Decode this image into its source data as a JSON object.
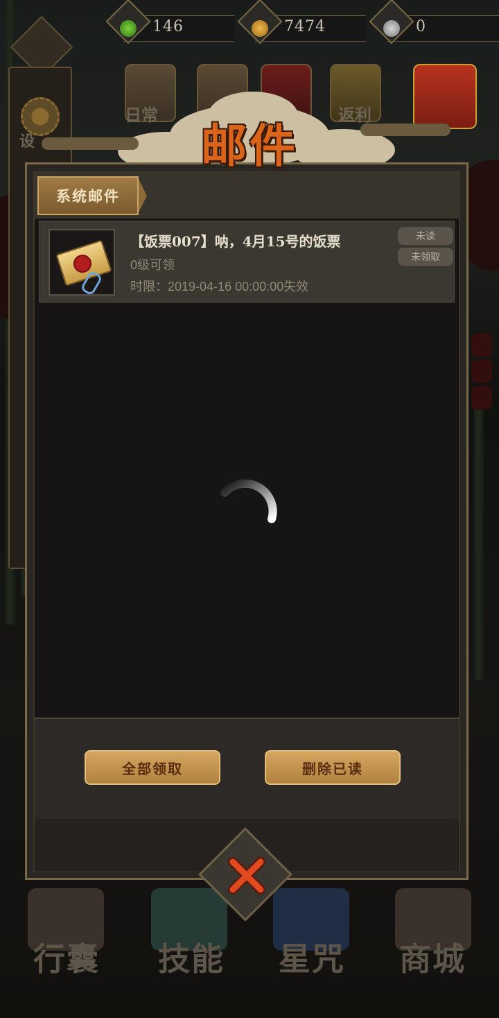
{
  "currency": {
    "jade": "146",
    "coin": "7474",
    "silver": "0"
  },
  "sidebar": {
    "settings_label": "设"
  },
  "events": {
    "daily_label": "日常",
    "rebate_label": "返利"
  },
  "mail_window": {
    "title": "邮件",
    "tab_label": "系统邮件",
    "items": [
      {
        "title": "【饭票007】呐，4月15号的饭票",
        "level": "0级可领",
        "deadline": "时限：2019-04-16  00:00:00失效",
        "read_status": "未读",
        "claim_status": "未领取"
      }
    ],
    "claim_all_label": "全部领取",
    "delete_read_label": "删除已读"
  },
  "bottom_nav": {
    "bag": "行囊",
    "skill": "技能",
    "star": "星咒",
    "shop": "商城"
  },
  "colors": {
    "title_orange": "#d9641a",
    "panel_border": "#7b6a4a",
    "gold_button": "#c49350"
  }
}
